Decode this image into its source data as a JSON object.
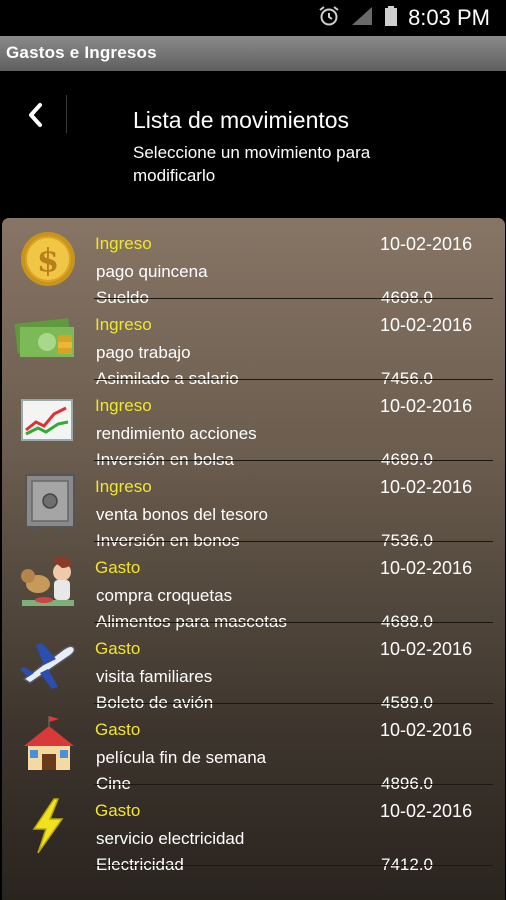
{
  "status_bar": {
    "time": "8:03 PM"
  },
  "app": {
    "title": "Gastos e Ingresos"
  },
  "header": {
    "title": "Lista de movimientos",
    "subtitle": "Seleccione un movimiento para modificarlo"
  },
  "movements": [
    {
      "type": "Ingreso",
      "date": "10-02-2016",
      "description": "pago quincena",
      "category": "Sueldo",
      "amount": "4698.0",
      "icon": "gold-coin-icon"
    },
    {
      "type": "Ingreso",
      "date": "10-02-2016",
      "description": "pago trabajo",
      "category": "Asimilado a salario",
      "amount": "7456.0",
      "icon": "money-bills-icon"
    },
    {
      "type": "Ingreso",
      "date": "10-02-2016",
      "description": "rendimiento acciones",
      "category": "Inversión en bolsa",
      "amount": "4689.0",
      "icon": "stock-chart-icon"
    },
    {
      "type": "Ingreso",
      "date": "10-02-2016",
      "description": "venta bonos del tesoro",
      "category": "Inversión en bonos",
      "amount": "7536.0",
      "icon": "safe-icon"
    },
    {
      "type": "Gasto",
      "date": "10-02-2016",
      "description": "compra croquetas",
      "category": "Alimentos para mascotas",
      "amount": "4688.0",
      "icon": "pet-feeding-icon"
    },
    {
      "type": "Gasto",
      "date": "10-02-2016",
      "description": "visita familiares",
      "category": "Boleto de avión",
      "amount": "4589.0",
      "icon": "airplane-icon"
    },
    {
      "type": "Gasto",
      "date": "10-02-2016",
      "description": "película fin de semana",
      "category": "Cine",
      "amount": "4896.0",
      "icon": "cinema-icon"
    },
    {
      "type": "Gasto",
      "date": "10-02-2016",
      "description": "servicio electricidad",
      "category": "Electricidad",
      "amount": "7412.0",
      "icon": "lightning-icon"
    }
  ]
}
